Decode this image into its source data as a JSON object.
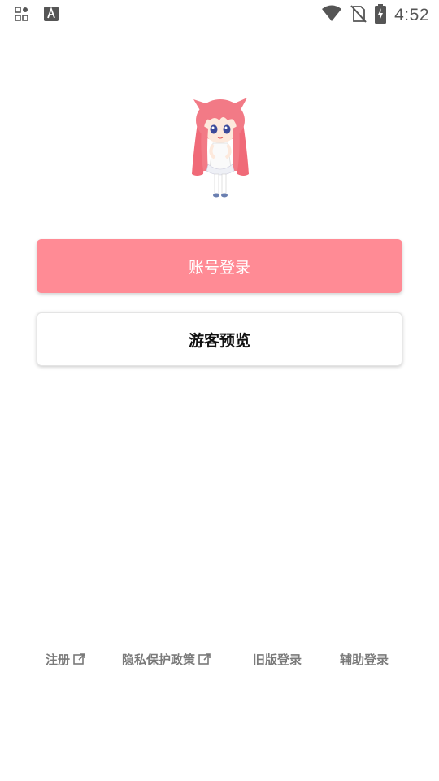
{
  "status_bar": {
    "time": "4:52",
    "icons": [
      "apps-grid-icon",
      "font-a-icon",
      "wifi-icon",
      "no-sim-icon",
      "battery-charging-icon"
    ]
  },
  "login": {
    "mascot_icon": "pink-hair-girl-mascot",
    "primary_button": "账号登录",
    "secondary_button": "游客预览"
  },
  "footer": {
    "links": [
      {
        "label": "注册",
        "icon": "external-link-icon"
      },
      {
        "label": "隐私保护政策",
        "icon": "external-link-icon"
      },
      {
        "label": "旧版登录"
      },
      {
        "label": "辅助登录"
      }
    ]
  },
  "colors": {
    "primary": "#ff8b95",
    "link_text": "#7a7a7a",
    "status_icon": "#555555"
  }
}
